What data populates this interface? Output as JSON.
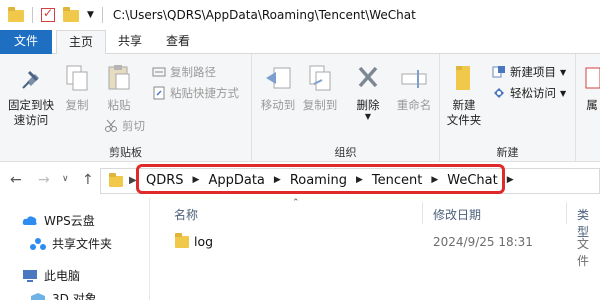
{
  "window": {
    "title_path": "C:\\Users\\QDRS\\AppData\\Roaming\\Tencent\\WeChat"
  },
  "ribbon_tabs": [
    "文件",
    "主页",
    "共享",
    "查看"
  ],
  "ribbon": {
    "clipboard": {
      "label": "剪贴板",
      "pin": "固定到快",
      "pin2": "速访问",
      "copy": "复制",
      "paste": "粘贴",
      "copy_path": "复制路径",
      "paste_shortcut": "粘贴快捷方式",
      "cut": "剪切"
    },
    "organize": {
      "label": "组织",
      "move_to": "移动到",
      "copy_to": "复制到",
      "delete": "删除",
      "rename": "重命名"
    },
    "new": {
      "label": "新建",
      "new_folder": "新建",
      "new_folder2": "文件夹",
      "new_item": "新建项目",
      "easy_access": "轻松访问"
    },
    "open_partial": "属"
  },
  "breadcrumb": [
    "QDRS",
    "AppData",
    "Roaming",
    "Tencent",
    "WeChat"
  ],
  "nav_pane": {
    "items": [
      "WPS云盘",
      "共享文件夹",
      "此电脑",
      "3D 对象"
    ]
  },
  "file_list": {
    "columns": {
      "name": "名称",
      "modified": "修改日期",
      "type": "类型"
    },
    "rows": [
      {
        "name": "log",
        "modified": "2024/9/25 18:31",
        "type": "文件"
      }
    ]
  },
  "colors": {
    "file_tab": "#1e6ec2",
    "highlight": "#e02a2a",
    "folder": "#f1c94a"
  }
}
